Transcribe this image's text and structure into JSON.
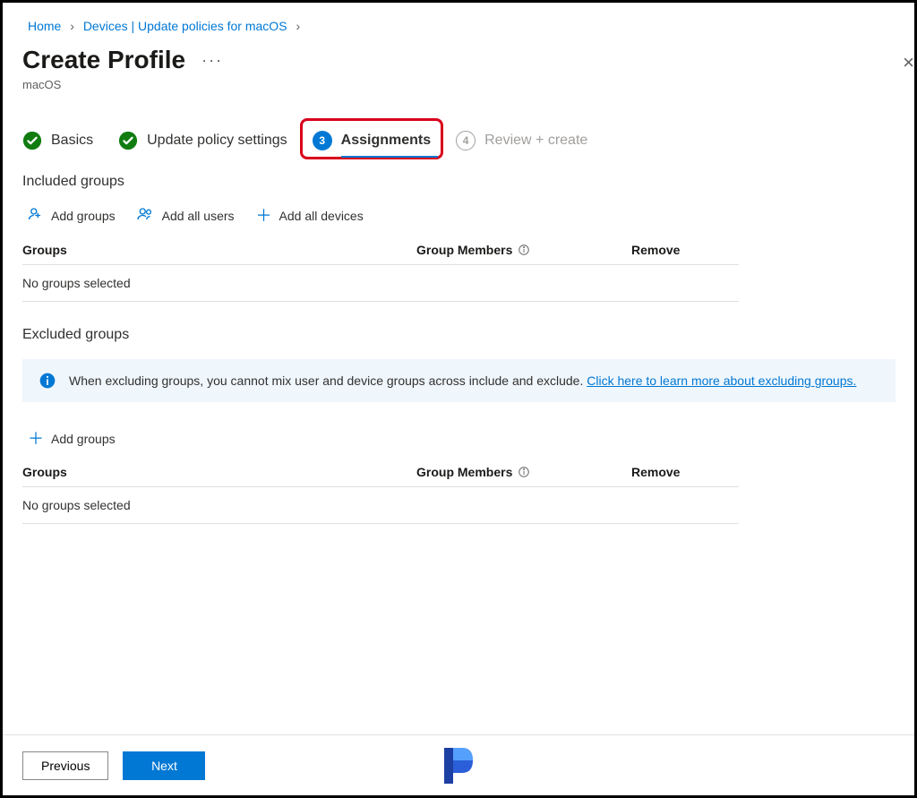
{
  "breadcrumb": {
    "items": [
      {
        "label": "Home"
      },
      {
        "label": "Devices | Update policies for macOS"
      }
    ]
  },
  "page": {
    "title": "Create Profile",
    "subtitle": "macOS"
  },
  "steps": [
    {
      "label": "Basics",
      "state": "done"
    },
    {
      "label": "Update policy settings",
      "state": "done"
    },
    {
      "label": "Assignments",
      "state": "current",
      "number": "3"
    },
    {
      "label": "Review + create",
      "state": "disabled",
      "number": "4"
    }
  ],
  "included": {
    "heading": "Included groups",
    "actions": {
      "add_groups": "Add groups",
      "add_all_users": "Add all users",
      "add_all_devices": "Add all devices"
    },
    "columns": {
      "groups": "Groups",
      "members": "Group Members",
      "remove": "Remove"
    },
    "empty": "No groups selected"
  },
  "excluded": {
    "heading": "Excluded groups",
    "info_text": "When excluding groups, you cannot mix user and device groups across include and exclude. ",
    "info_link": "Click here to learn more about excluding groups.",
    "actions": {
      "add_groups": "Add groups"
    },
    "columns": {
      "groups": "Groups",
      "members": "Group Members",
      "remove": "Remove"
    },
    "empty": "No groups selected"
  },
  "footer": {
    "previous": "Previous",
    "next": "Next"
  }
}
